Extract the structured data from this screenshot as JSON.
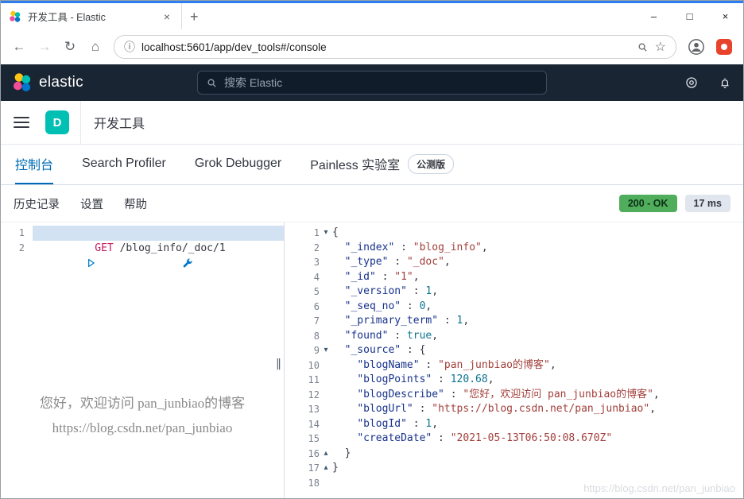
{
  "browser": {
    "tab_title": "开发工具 - Elastic",
    "url": "localhost:5601/app/dev_tools#/console",
    "glyphs": {
      "back": "←",
      "forward": "→",
      "reload": "↻",
      "home": "⌂",
      "info": "ⓘ",
      "star": "☆",
      "new_tab": "+",
      "minimize": "–",
      "maximize": "□",
      "close": "×"
    }
  },
  "app_header": {
    "brand": "elastic",
    "search_placeholder": "搜索 Elastic"
  },
  "nav": {
    "space_badge": "D",
    "page_title": "开发工具"
  },
  "tabs": [
    {
      "key": "console",
      "label": "控制台",
      "active": true
    },
    {
      "key": "search-profiler",
      "label": "Search Profiler",
      "active": false
    },
    {
      "key": "grok-debugger",
      "label": "Grok Debugger",
      "active": false
    },
    {
      "key": "painless-lab",
      "label": "Painless 实验室",
      "active": false,
      "badge": "公测版"
    }
  ],
  "toolbar": {
    "links": [
      {
        "key": "history",
        "label": "历史记录"
      },
      {
        "key": "settings",
        "label": "设置"
      },
      {
        "key": "help",
        "label": "帮助"
      }
    ],
    "status": "200 - OK",
    "time": "17 ms"
  },
  "request_editor": {
    "lines": [
      {
        "n": "1",
        "tokens": [
          [
            "m",
            "GET"
          ],
          [
            "w",
            " "
          ],
          [
            "u",
            "/blog_info/_doc/1"
          ]
        ]
      },
      {
        "n": "2",
        "tokens": []
      }
    ],
    "watermark": [
      "您好，欢迎访问 pan_junbiao的博客",
      "https://blog.csdn.net/pan_junbiao"
    ]
  },
  "response_editor": {
    "lines": [
      {
        "n": "1",
        "fold": "down",
        "tokens": [
          [
            "p",
            "{"
          ]
        ]
      },
      {
        "n": "2",
        "tokens": [
          [
            "w",
            "  "
          ],
          [
            "k",
            "\"_index\""
          ],
          [
            "p",
            " : "
          ],
          [
            "s",
            "\"blog_info\""
          ],
          [
            "p",
            ","
          ]
        ]
      },
      {
        "n": "3",
        "tokens": [
          [
            "w",
            "  "
          ],
          [
            "k",
            "\"_type\""
          ],
          [
            "p",
            " : "
          ],
          [
            "s",
            "\"_doc\""
          ],
          [
            "p",
            ","
          ]
        ]
      },
      {
        "n": "4",
        "tokens": [
          [
            "w",
            "  "
          ],
          [
            "k",
            "\"_id\""
          ],
          [
            "p",
            " : "
          ],
          [
            "s",
            "\"1\""
          ],
          [
            "p",
            ","
          ]
        ]
      },
      {
        "n": "5",
        "tokens": [
          [
            "w",
            "  "
          ],
          [
            "k",
            "\"_version\""
          ],
          [
            "p",
            " : "
          ],
          [
            "n",
            "1"
          ],
          [
            "p",
            ","
          ]
        ]
      },
      {
        "n": "6",
        "tokens": [
          [
            "w",
            "  "
          ],
          [
            "k",
            "\"_seq_no\""
          ],
          [
            "p",
            " : "
          ],
          [
            "n",
            "0"
          ],
          [
            "p",
            ","
          ]
        ]
      },
      {
        "n": "7",
        "tokens": [
          [
            "w",
            "  "
          ],
          [
            "k",
            "\"_primary_term\""
          ],
          [
            "p",
            " : "
          ],
          [
            "n",
            "1"
          ],
          [
            "p",
            ","
          ]
        ]
      },
      {
        "n": "8",
        "tokens": [
          [
            "w",
            "  "
          ],
          [
            "k",
            "\"found\""
          ],
          [
            "p",
            " : "
          ],
          [
            "b",
            "true"
          ],
          [
            "p",
            ","
          ]
        ]
      },
      {
        "n": "9",
        "fold": "down",
        "tokens": [
          [
            "w",
            "  "
          ],
          [
            "k",
            "\"_source\""
          ],
          [
            "p",
            " : {"
          ]
        ]
      },
      {
        "n": "10",
        "tokens": [
          [
            "w",
            "    "
          ],
          [
            "k",
            "\"blogName\""
          ],
          [
            "p",
            " : "
          ],
          [
            "s",
            "\"pan_junbiao的博客\""
          ],
          [
            "p",
            ","
          ]
        ]
      },
      {
        "n": "11",
        "tokens": [
          [
            "w",
            "    "
          ],
          [
            "k",
            "\"blogPoints\""
          ],
          [
            "p",
            " : "
          ],
          [
            "n",
            "120.68"
          ],
          [
            "p",
            ","
          ]
        ]
      },
      {
        "n": "12",
        "tokens": [
          [
            "w",
            "    "
          ],
          [
            "k",
            "\"blogDescribe\""
          ],
          [
            "p",
            " : "
          ],
          [
            "s",
            "\"您好，欢迎访问 pan_junbiao的博客\""
          ],
          [
            "p",
            ","
          ]
        ]
      },
      {
        "n": "13",
        "tokens": [
          [
            "w",
            "    "
          ],
          [
            "k",
            "\"blogUrl\""
          ],
          [
            "p",
            " : "
          ],
          [
            "s",
            "\"https://blog.csdn.net/pan_junbiao\""
          ],
          [
            "p",
            ","
          ]
        ]
      },
      {
        "n": "14",
        "tokens": [
          [
            "w",
            "    "
          ],
          [
            "k",
            "\"blogId\""
          ],
          [
            "p",
            " : "
          ],
          [
            "n",
            "1"
          ],
          [
            "p",
            ","
          ]
        ]
      },
      {
        "n": "15",
        "tokens": [
          [
            "w",
            "    "
          ],
          [
            "k",
            "\"createDate\""
          ],
          [
            "p",
            " : "
          ],
          [
            "s",
            "\"2021-05-13T06:50:08.670Z\""
          ]
        ]
      },
      {
        "n": "16",
        "fold": "up",
        "tokens": [
          [
            "w",
            "  "
          ],
          [
            "p",
            "}"
          ]
        ]
      },
      {
        "n": "17",
        "fold": "up",
        "tokens": [
          [
            "p",
            "}"
          ]
        ]
      },
      {
        "n": "18",
        "tokens": []
      }
    ]
  },
  "corner_watermark": "https://blog.csdn.net/pan_junbiao",
  "colors": {
    "accent": "#006bb4",
    "success_badge": "#4fad5b",
    "header_bg": "#1a2533",
    "space_badge": "#00bfb3",
    "selection": "#d2e2f3",
    "method": "#c2185b"
  }
}
